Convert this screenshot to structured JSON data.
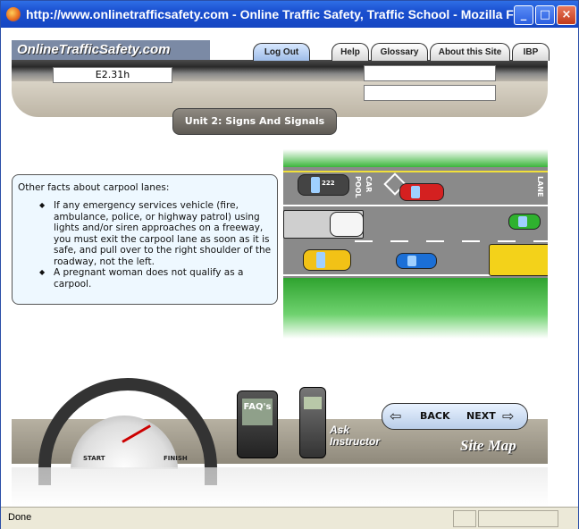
{
  "window": {
    "title": "http://www.onlinetrafficsafety.com - Online Traffic Safety, Traffic School - Mozilla Fi...",
    "minimize_icon": "minimize-icon",
    "maximize_icon": "maximize-icon",
    "close_icon": "close-icon",
    "minimize_glyph": "_",
    "maximize_glyph": "□",
    "close_glyph": "×"
  },
  "header": {
    "logo_text": "OnlineTrafficSafety.com",
    "tabs": [
      {
        "label": "Log Out"
      },
      {
        "label": "Help"
      },
      {
        "label": "Glossary"
      },
      {
        "label": "About this Site"
      },
      {
        "label": "IBP"
      }
    ],
    "section_code": "E2.31h",
    "unit_title": "Unit 2: Signs And Signals",
    "right_field_1": "",
    "right_field_2": ""
  },
  "info_box": {
    "lead": "Other facts about carpool lanes:",
    "items": [
      "If any emergency services vehicle (fire, ambulance, police, or highway patrol) using lights and/or siren approaches on a freeway, you must exit the carpool lane as soon as it is safe, and pull over to the right shoulder of the roadway, not the left.",
      "A pregnant woman does not qualify as a carpool."
    ]
  },
  "scene": {
    "lane_text_1": "CAR",
    "lane_text_2": "POOL",
    "lane_text_3": "LANE",
    "badge": "222"
  },
  "bottom": {
    "gauge_start": "START",
    "gauge_finish": "FINISH",
    "faq_label": "FAQ's",
    "ask_label_1": "Ask",
    "ask_label_2": "Instructor",
    "back_label": "BACK",
    "next_label": "NEXT",
    "site_map": "Site Map"
  },
  "status": {
    "text": "Done"
  },
  "colors": {
    "titlebar": "#1a4fcf",
    "info_bg": "#eef8ff",
    "road": "#8a8a8a",
    "grass": "#3bb53b"
  }
}
